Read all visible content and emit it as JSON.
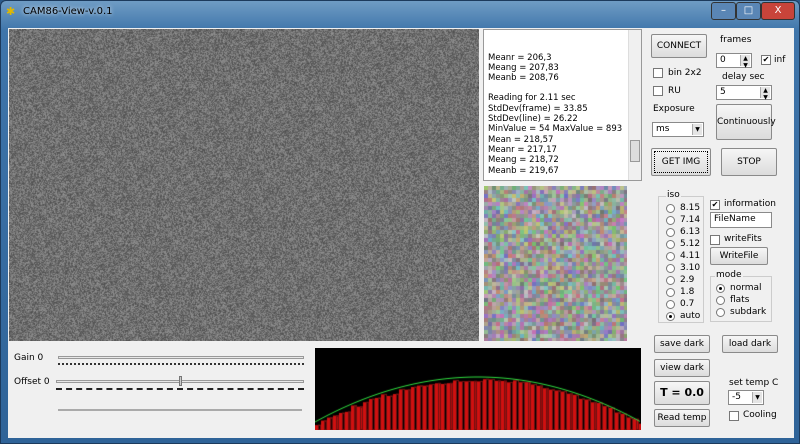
{
  "window": {
    "title": "CAM86-View-v.0.1",
    "minimize": "–",
    "maximize": "□",
    "close": "X"
  },
  "log": {
    "lines": [
      "Meanr = 206,3",
      "Meang = 207,83",
      "Meanb = 208,76",
      "",
      "Reading for 2.11 sec",
      "StdDev(frame) = 33.85",
      "StdDev(line) = 26.22",
      "MinValue = 54 MaxValue = 893",
      "Mean = 218,57",
      "Meanr = 217,17",
      "Meang = 218,72",
      "Meanb = 219,67"
    ]
  },
  "controls": {
    "connect": "CONNECT",
    "bin": "bin 2x2",
    "ru": "RU",
    "exposure_label": "Exposure",
    "exposure_value": "ms",
    "frames_label": "frames",
    "frames_value": "0",
    "inf_label": "inf",
    "delay_label": "delay sec",
    "delay_value": "5",
    "continuous": "Continuously",
    "get_img": "GET IMG",
    "stop": "STOP",
    "iso_label": "iso",
    "iso_options": [
      "8.15",
      "7.14",
      "6.13",
      "5.12",
      "4.11",
      "3.10",
      "2.9",
      "1.8",
      "0.7",
      "auto"
    ],
    "iso_selected": "auto",
    "information": "information",
    "filename": "FileName",
    "writefits": "writeFits",
    "writefile": "WriteFile",
    "mode_label": "mode",
    "modes": [
      "normal",
      "flats",
      "subdark"
    ],
    "mode_selected": "normal",
    "save_dark": "save dark",
    "load_dark": "load dark",
    "view_dark": "view dark",
    "temp": "T = 0.0 C",
    "read_temp": "Read temp",
    "set_temp_label": "set temp C",
    "set_temp_value": "-5",
    "cooling": "Cooling",
    "gain": "Gain 0",
    "offset": "Offset 0"
  },
  "colors": {
    "profile_bars": "#d01010",
    "profile_line": "#30e040",
    "plot_bg": "#000000"
  }
}
